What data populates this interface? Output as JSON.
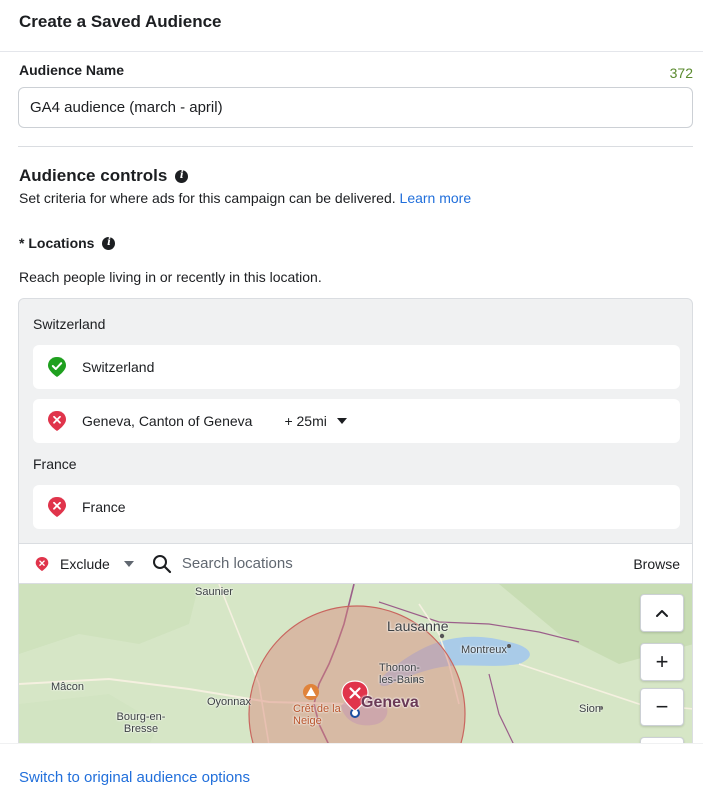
{
  "header": {
    "title": "Create a Saved Audience"
  },
  "audience_name": {
    "label": "Audience Name",
    "char_count": "372",
    "value": "GA4 audience (march - april)"
  },
  "audience_controls": {
    "title": "Audience controls",
    "description": "Set criteria for where ads for this campaign can be delivered.",
    "learn_more": "Learn more"
  },
  "locations": {
    "title": "* Locations",
    "description": "Reach people living in or recently in this location.",
    "groups": [
      {
        "country": "Switzerland",
        "items": [
          {
            "name": "Switzerland",
            "type": "include",
            "icon": "green-check-pin-icon"
          },
          {
            "name": "Geneva, Canton of Geneva",
            "type": "exclude",
            "icon": "red-x-pin-icon",
            "radius": "+ 25mi"
          }
        ]
      },
      {
        "country": "France",
        "items": [
          {
            "name": "France",
            "type": "exclude",
            "icon": "red-x-pin-icon"
          }
        ]
      }
    ],
    "search": {
      "mode": "Exclude",
      "placeholder": "Search locations",
      "browse": "Browse"
    }
  },
  "map": {
    "labels": [
      "Saunier",
      "Lausanne",
      "Montreux",
      "Thonon-les-Bains",
      "Mâcon",
      "Oyonnax",
      "Crêt de la Neige",
      "Geneva",
      "Bourg-en-Bresse",
      "Sion"
    ],
    "controls": {
      "collapse": "^",
      "zoom_in": "+",
      "zoom_out": "−"
    }
  },
  "footer": {
    "link": "Switch to original audience options"
  },
  "colors": {
    "accent": "#216fdb",
    "include": "#1fa01f",
    "exclude": "#e0344b",
    "count": "#5a8a2e"
  }
}
